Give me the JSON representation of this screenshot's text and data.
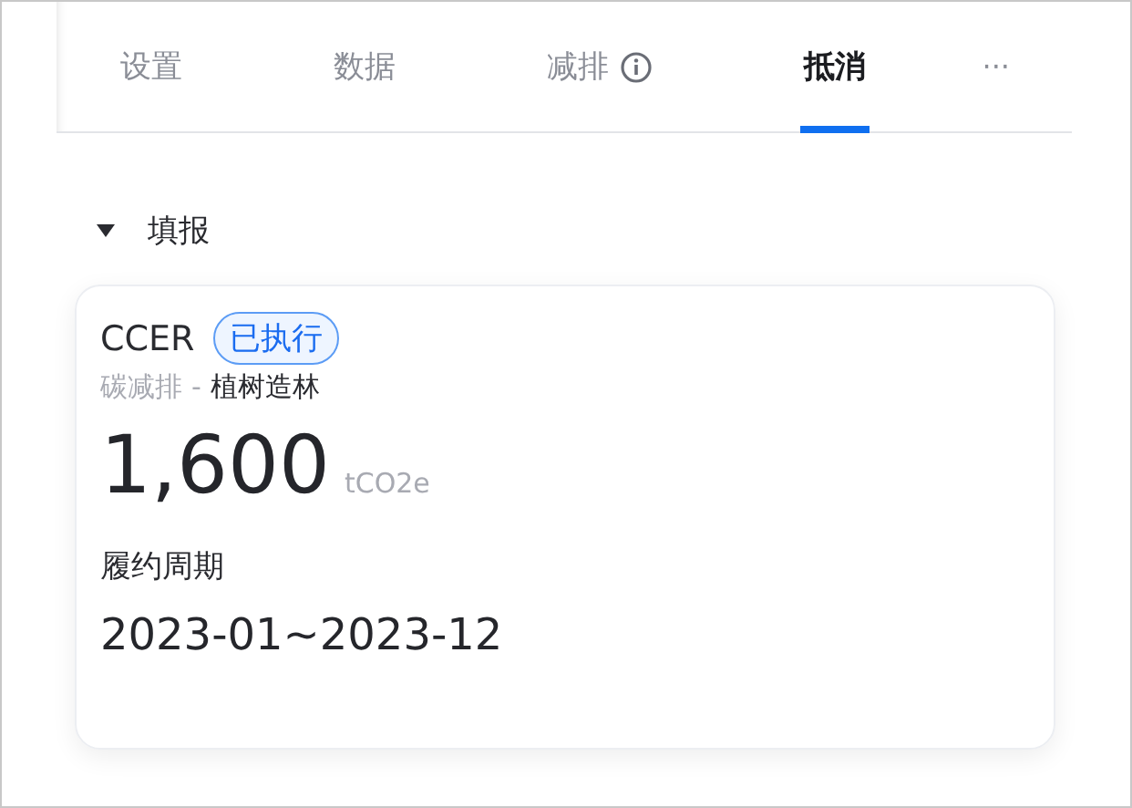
{
  "tabs": [
    {
      "label": "设置",
      "kind": "plain",
      "selected": false
    },
    {
      "label": "数据",
      "kind": "plain",
      "selected": false
    },
    {
      "label": "减排",
      "kind": "info",
      "selected": false
    },
    {
      "label": "抵消",
      "kind": "plain",
      "selected": true
    }
  ],
  "more": "···",
  "section": {
    "title": "填报",
    "expanded": true
  },
  "card": {
    "name": "CCER",
    "status": "已执行",
    "category": "碳减排",
    "separator": "-",
    "project": "植树造林",
    "amount": "1,600",
    "unit": "tCO2e",
    "period_label": "履约周期",
    "period": "2023-01~2023-12"
  }
}
